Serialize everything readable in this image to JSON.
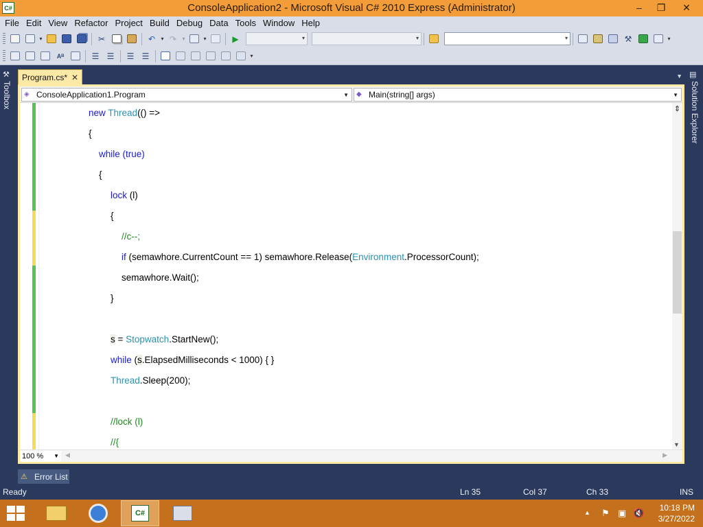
{
  "window": {
    "title": "ConsoleApplication2 - Microsoft Visual C# 2010 Express (Administrator)",
    "app_icon_text": "C#",
    "minimize": "–",
    "maximize": "❐",
    "close": "✕"
  },
  "menu": [
    "File",
    "Edit",
    "View",
    "Refactor",
    "Project",
    "Build",
    "Debug",
    "Data",
    "Tools",
    "Window",
    "Help"
  ],
  "side_panels": {
    "left": "Toolbox",
    "right": "Solution Explorer"
  },
  "document_tab": {
    "label": "Program.cs*",
    "close": "✕"
  },
  "navigation": {
    "type_combo": "ConsoleApplication1.Program",
    "member_combo": "Main(string[] args)"
  },
  "code_lines": [
    [
      {
        "t": "new ",
        "c": "kw"
      },
      {
        "t": "Thread",
        "c": "ty"
      },
      {
        "t": "(() =>"
      }
    ],
    [
      {
        "t": "{"
      }
    ],
    [
      {
        "t": "while ",
        "c": "kw"
      },
      {
        "t": "(",
        "c": "kw"
      },
      {
        "t": "true",
        "c": "kw"
      },
      {
        "t": ")",
        "c": "kw"
      }
    ],
    [
      {
        "t": "{"
      }
    ],
    [
      {
        "t": "lock ",
        "c": "kw"
      },
      {
        "t": "(l)"
      }
    ],
    [
      {
        "t": "{"
      }
    ],
    [
      {
        "t": "//c--;",
        "c": "cm"
      }
    ],
    [
      {
        "t": "if ",
        "c": "kw"
      },
      {
        "t": "(semawhore.CurrentCount == 1) semawhore.Release("
      },
      {
        "t": "Environment",
        "c": "ty"
      },
      {
        "t": ".ProcessorCount);"
      }
    ],
    [
      {
        "t": "semawhore.Wait();"
      }
    ],
    [
      {
        "t": "}"
      }
    ],
    [],
    [
      {
        "t": "s",
        "c": "hl"
      },
      {
        "t": " = "
      },
      {
        "t": "Stopwatch",
        "c": "ty"
      },
      {
        "t": ".StartNew();"
      }
    ],
    [
      {
        "t": "while ",
        "c": "kw"
      },
      {
        "t": "("
      },
      {
        "t": "s",
        "c": "hl"
      },
      {
        "t": ".ElapsedMilliseconds < 1000) { }"
      }
    ],
    [
      {
        "t": "Thread",
        "c": "ty"
      },
      {
        "t": ".Sleep(200);"
      }
    ],
    [],
    [
      {
        "t": "//lock (l)",
        "c": "cm"
      }
    ],
    [
      {
        "t": "//{",
        "c": "cm"
      }
    ]
  ],
  "editor": {
    "zoom": "100 %"
  },
  "bottom_panel": {
    "error_list": "Error List"
  },
  "status": {
    "text": "Ready",
    "ln": "Ln 35",
    "col": "Col 37",
    "ch": "Ch 33",
    "mode": "INS"
  },
  "taskbar": {
    "time": "10:18 PM",
    "date": "3/27/2022"
  }
}
